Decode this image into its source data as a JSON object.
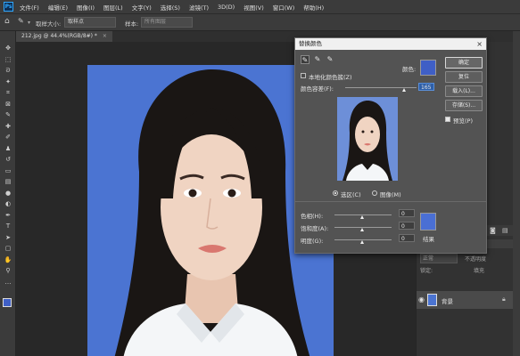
{
  "app": {
    "logo": "Ps"
  },
  "menubar": [
    "文件(F)",
    "编辑(E)",
    "图像(I)",
    "图层(L)",
    "文字(Y)",
    "选择(S)",
    "滤镜(T)",
    "3D(D)",
    "视图(V)",
    "窗口(W)",
    "帮助(H)"
  ],
  "options": {
    "sample_size_label": "取样大小:",
    "sample_size_value": "取样点",
    "sample_label": "样本:",
    "sample_value": "所有图层"
  },
  "document": {
    "tab_title": "212.jpg @ 44.4%(RGB/8#) *"
  },
  "dialog": {
    "title": "替换颜色",
    "close": "×",
    "localized_label": "本地化颜色簇(Z)",
    "localized_checked": false,
    "color_label": "颜色:",
    "swatch_color": "#3f5fc6",
    "fuzziness_label": "颜色容差(F):",
    "fuzziness_value": "165",
    "fuzziness_fraction": 0.825,
    "mode_selection": "选区(C)",
    "mode_image": "图像(M)",
    "selected_mode": "selection",
    "buttons": {
      "ok": "确定",
      "reset": "复位",
      "load": "载入(L)...",
      "save": "存储(S)..."
    },
    "preview_label": "预览(P)",
    "preview_checked": true,
    "hue_label": "色相(H):",
    "hue_value": "0",
    "saturation_label": "饱和度(A):",
    "saturation_value": "0",
    "lightness_label": "明度(G):",
    "lightness_value": "0",
    "result_label": "结果",
    "result_color": "#4a6fd4"
  },
  "layers": {
    "kind_label": "正常",
    "opacity_label": "不透明度",
    "fill_label": "填充",
    "lock_label": "锁定:",
    "layer_name": "背景"
  },
  "colors": {
    "photo_bg": "#4b74d2",
    "ui_dark": "#2b2b2b",
    "ui_panel": "#3b3b3b",
    "dialog_bg": "#535353"
  }
}
